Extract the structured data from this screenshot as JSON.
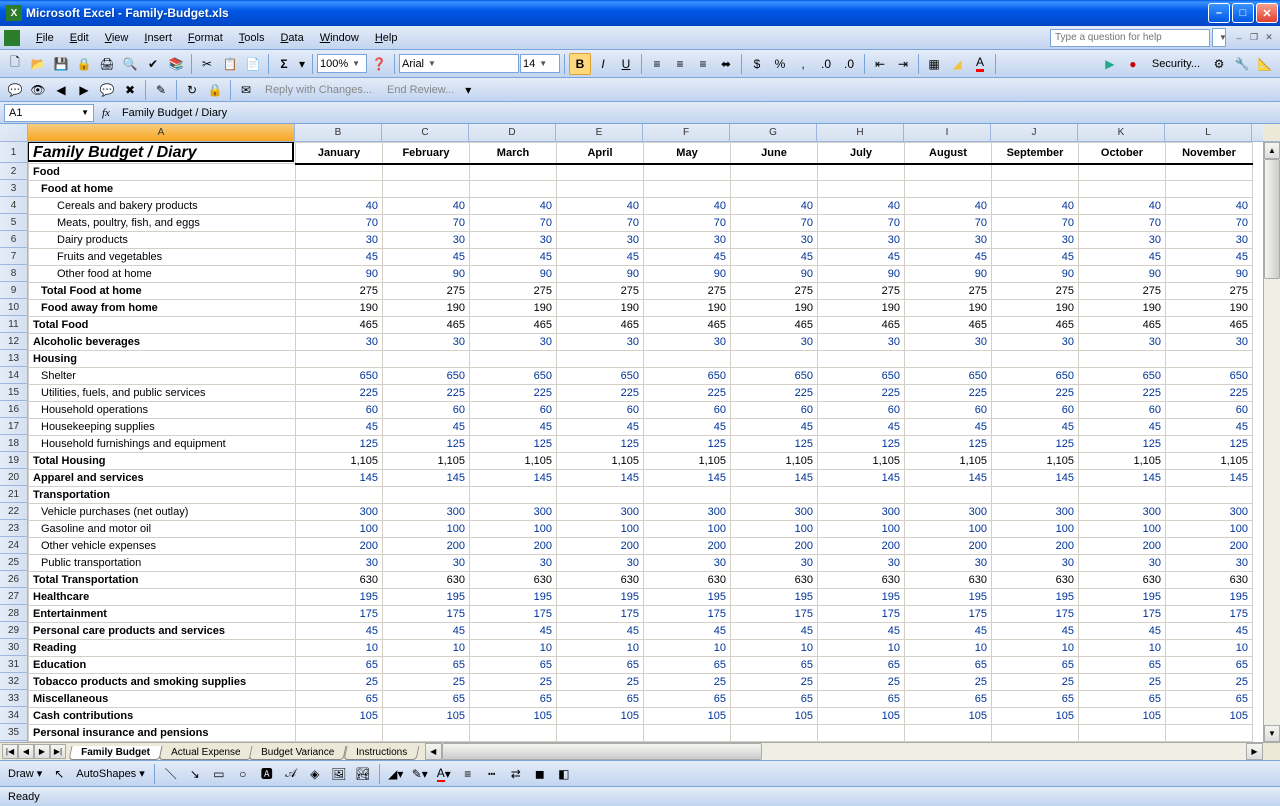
{
  "title": "Microsoft Excel - Family-Budget.xls",
  "menus": [
    "File",
    "Edit",
    "View",
    "Insert",
    "Format",
    "Tools",
    "Data",
    "Window",
    "Help"
  ],
  "help_placeholder": "Type a question for help",
  "zoom": "100%",
  "font_name": "Arial",
  "font_size": "14",
  "security_label": "Security...",
  "reply_label": "Reply with Changes...",
  "end_review_label": "End Review...",
  "name_box": "A1",
  "formula": "Family Budget / Diary",
  "columns": [
    "A",
    "B",
    "C",
    "D",
    "E",
    "F",
    "G",
    "H",
    "I",
    "J",
    "K",
    "L"
  ],
  "month_headers": [
    "January",
    "February",
    "March",
    "April",
    "May",
    "June",
    "July",
    "August",
    "September",
    "October",
    "November"
  ],
  "col_widths": {
    "A": 267,
    "other": 87
  },
  "rows": [
    {
      "n": 1,
      "type": "title",
      "label": "Family Budget / Diary"
    },
    {
      "n": 2,
      "type": "section",
      "label": "Food"
    },
    {
      "n": 3,
      "type": "sub",
      "ind": 1,
      "label": "Food at home"
    },
    {
      "n": 4,
      "type": "item",
      "ind": 2,
      "label": "Cereals and bakery products",
      "val": 40
    },
    {
      "n": 5,
      "type": "item",
      "ind": 2,
      "label": "Meats, poultry, fish, and eggs",
      "val": 70
    },
    {
      "n": 6,
      "type": "item",
      "ind": 2,
      "label": "Dairy products",
      "val": 30
    },
    {
      "n": 7,
      "type": "item",
      "ind": 2,
      "label": "Fruits and vegetables",
      "val": 45
    },
    {
      "n": 8,
      "type": "item",
      "ind": 2,
      "label": "Other food at home",
      "val": 90
    },
    {
      "n": 9,
      "type": "total",
      "ind": 1,
      "label": "Total Food at home",
      "val": 275
    },
    {
      "n": 10,
      "type": "total",
      "ind": 1,
      "label": "Food away from home",
      "val": 190
    },
    {
      "n": 11,
      "type": "total",
      "label": "Total Food",
      "val": 465
    },
    {
      "n": 12,
      "type": "total",
      "label": "Alcoholic beverages",
      "val": 30,
      "blue": true
    },
    {
      "n": 13,
      "type": "section",
      "label": "Housing"
    },
    {
      "n": 14,
      "type": "item",
      "ind": 1,
      "label": "Shelter",
      "val": 650
    },
    {
      "n": 15,
      "type": "item",
      "ind": 1,
      "label": "Utilities, fuels, and public services",
      "val": 225
    },
    {
      "n": 16,
      "type": "item",
      "ind": 1,
      "label": "Household operations",
      "val": 60
    },
    {
      "n": 17,
      "type": "item",
      "ind": 1,
      "label": "Housekeeping supplies",
      "val": 45
    },
    {
      "n": 18,
      "type": "item",
      "ind": 1,
      "label": "Household furnishings and equipment",
      "val": 125
    },
    {
      "n": 19,
      "type": "total",
      "label": "Total Housing",
      "val": "1,105"
    },
    {
      "n": 20,
      "type": "total",
      "label": "Apparel and services",
      "val": 145,
      "blue": true
    },
    {
      "n": 21,
      "type": "section",
      "label": "Transportation"
    },
    {
      "n": 22,
      "type": "item",
      "ind": 1,
      "label": "Vehicle purchases (net outlay)",
      "val": 300
    },
    {
      "n": 23,
      "type": "item",
      "ind": 1,
      "label": "Gasoline and motor oil",
      "val": 100
    },
    {
      "n": 24,
      "type": "item",
      "ind": 1,
      "label": "Other vehicle expenses",
      "val": 200
    },
    {
      "n": 25,
      "type": "item",
      "ind": 1,
      "label": "Public transportation",
      "val": 30
    },
    {
      "n": 26,
      "type": "total",
      "label": "Total Transportation",
      "val": 630
    },
    {
      "n": 27,
      "type": "total",
      "label": "Healthcare",
      "val": 195,
      "blue": true
    },
    {
      "n": 28,
      "type": "total",
      "label": "Entertainment",
      "val": 175,
      "blue": true
    },
    {
      "n": 29,
      "type": "total",
      "label": "Personal care products and services",
      "val": 45,
      "blue": true
    },
    {
      "n": 30,
      "type": "total",
      "label": "Reading",
      "val": 10,
      "blue": true
    },
    {
      "n": 31,
      "type": "total",
      "label": "Education",
      "val": 65,
      "blue": true
    },
    {
      "n": 32,
      "type": "total",
      "label": "Tobacco products and smoking supplies",
      "val": 25,
      "blue": true
    },
    {
      "n": 33,
      "type": "total",
      "label": "Miscellaneous",
      "val": 65,
      "blue": true
    },
    {
      "n": 34,
      "type": "total",
      "label": "Cash contributions",
      "val": 105,
      "blue": true
    },
    {
      "n": 35,
      "type": "section",
      "label": "Personal insurance and pensions"
    }
  ],
  "sheet_tabs": [
    "Family Budget",
    "Actual Expense",
    "Budget Variance",
    "Instructions"
  ],
  "active_tab": 0,
  "draw_label": "Draw",
  "autoshapes_label": "AutoShapes",
  "status": "Ready"
}
